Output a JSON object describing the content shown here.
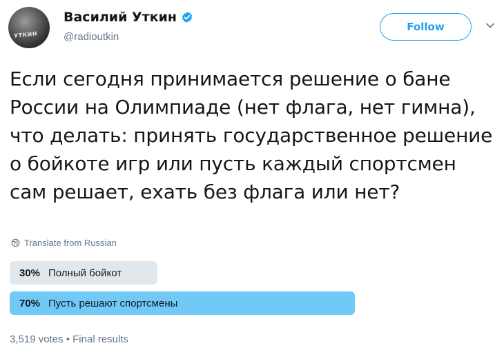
{
  "author": {
    "display_name": "Василий Уткин",
    "handle": "@radioutkin",
    "avatar_badge_text": "УТКИН",
    "verified_icon": "verified-badge-icon"
  },
  "actions": {
    "follow_label": "Follow",
    "more_icon": "chevron-down-icon"
  },
  "tweet": {
    "text": "Если сегодня принимается решение о бане России на Олимпиаде (нет флага, нет гимна), что делать: принять государственное решение о бойкоте игр или пусть каждый спортсмен сам решает, ехать без флага или нет?",
    "translate_label": "Translate from Russian",
    "translate_icon": "globe-icon"
  },
  "poll": {
    "options": [
      {
        "percent": "30%",
        "label": "Полный бойкот",
        "share": 0.3,
        "leading": false
      },
      {
        "percent": "70%",
        "label": "Пусть решают спортсмены",
        "share": 0.7,
        "leading": true
      }
    ],
    "meta": "3,519 votes • Final results"
  },
  "colors": {
    "accent": "#1da1f2",
    "poll_leading": "#71c9f8",
    "poll_other": "#e1e8ed",
    "secondary_text": "#657786"
  }
}
